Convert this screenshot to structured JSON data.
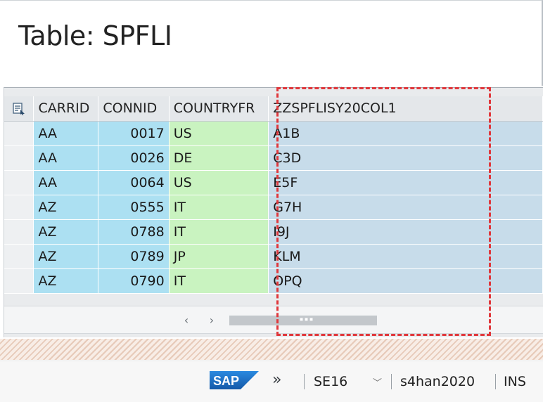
{
  "page": {
    "title": "Table: SPFLI"
  },
  "grid": {
    "columns": [
      {
        "key": "carrid",
        "label": "CARRID"
      },
      {
        "key": "connid",
        "label": "CONNID"
      },
      {
        "key": "country",
        "label": "COUNTRYFR"
      },
      {
        "key": "zz",
        "label": "ZZSPFLISY20COL1"
      }
    ],
    "rows": [
      [
        "AA",
        "0017",
        "US",
        "A1B"
      ],
      [
        "AA",
        "0026",
        "DE",
        "C3D"
      ],
      [
        "AA",
        "0064",
        "US",
        "E5F"
      ],
      [
        "AZ",
        "0555",
        "IT",
        "G7H"
      ],
      [
        "AZ",
        "0788",
        "IT",
        "I9J"
      ],
      [
        "AZ",
        "0789",
        "JP",
        "KLM"
      ],
      [
        "AZ",
        "0790",
        "IT",
        "OPQ"
      ]
    ],
    "icons": {
      "layout": "layout-settings-icon",
      "scroll_left": "chevron-left-icon",
      "scroll_right": "chevron-right-icon"
    }
  },
  "statusbar": {
    "logo": "SAP",
    "expand_glyph": "»",
    "tcode": "SE16",
    "system": "s4han2020",
    "mode": "INS"
  },
  "colors": {
    "key_columns": "#ace0f2",
    "country_column": "#c9f3c0",
    "custom_column": "#c7dcea",
    "highlight": "#e0373b",
    "sap_blue": "#1b70c4"
  }
}
